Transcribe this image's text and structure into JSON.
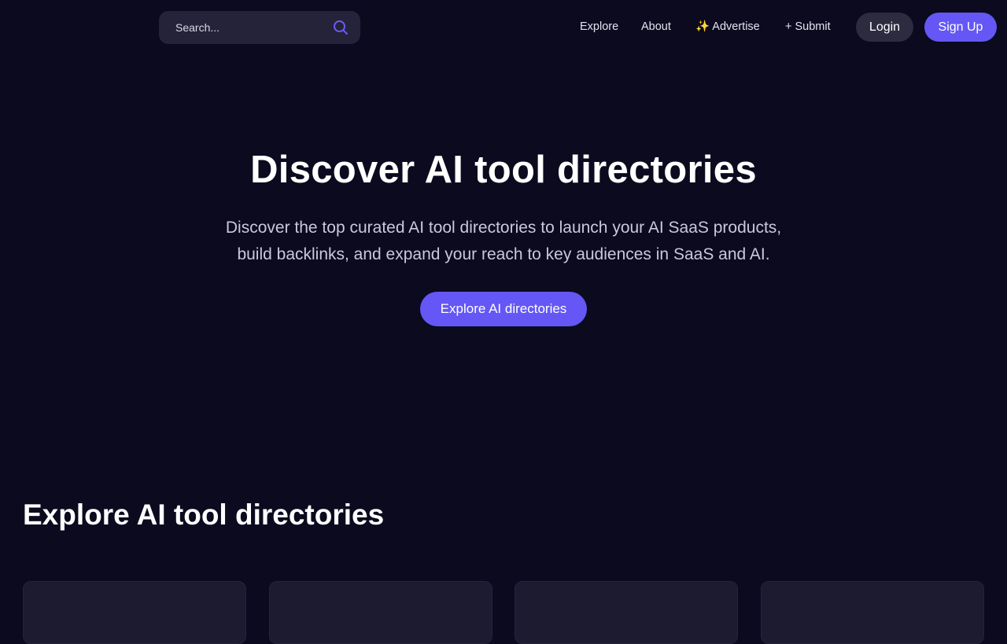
{
  "header": {
    "search": {
      "placeholder": "Search...",
      "icon": "search-icon"
    },
    "nav": [
      {
        "label": "Explore"
      },
      {
        "label": "About"
      },
      {
        "label": "✨ Advertise"
      },
      {
        "label": "+ Submit"
      }
    ],
    "login_label": "Login",
    "signup_label": "Sign Up"
  },
  "hero": {
    "title": "Discover AI tool directories",
    "subtitle_line1": "Discover the top curated AI tool directories to launch your AI SaaS products,",
    "subtitle_line2": "build backlinks, and expand your reach to key audiences in SaaS and AI.",
    "cta_label": "Explore AI directories"
  },
  "section": {
    "title": "Explore AI tool directories"
  },
  "colors": {
    "background": "#0b0a1f",
    "accent": "#6457f5",
    "surface": "#24233a",
    "card": "#1c1b2f"
  }
}
